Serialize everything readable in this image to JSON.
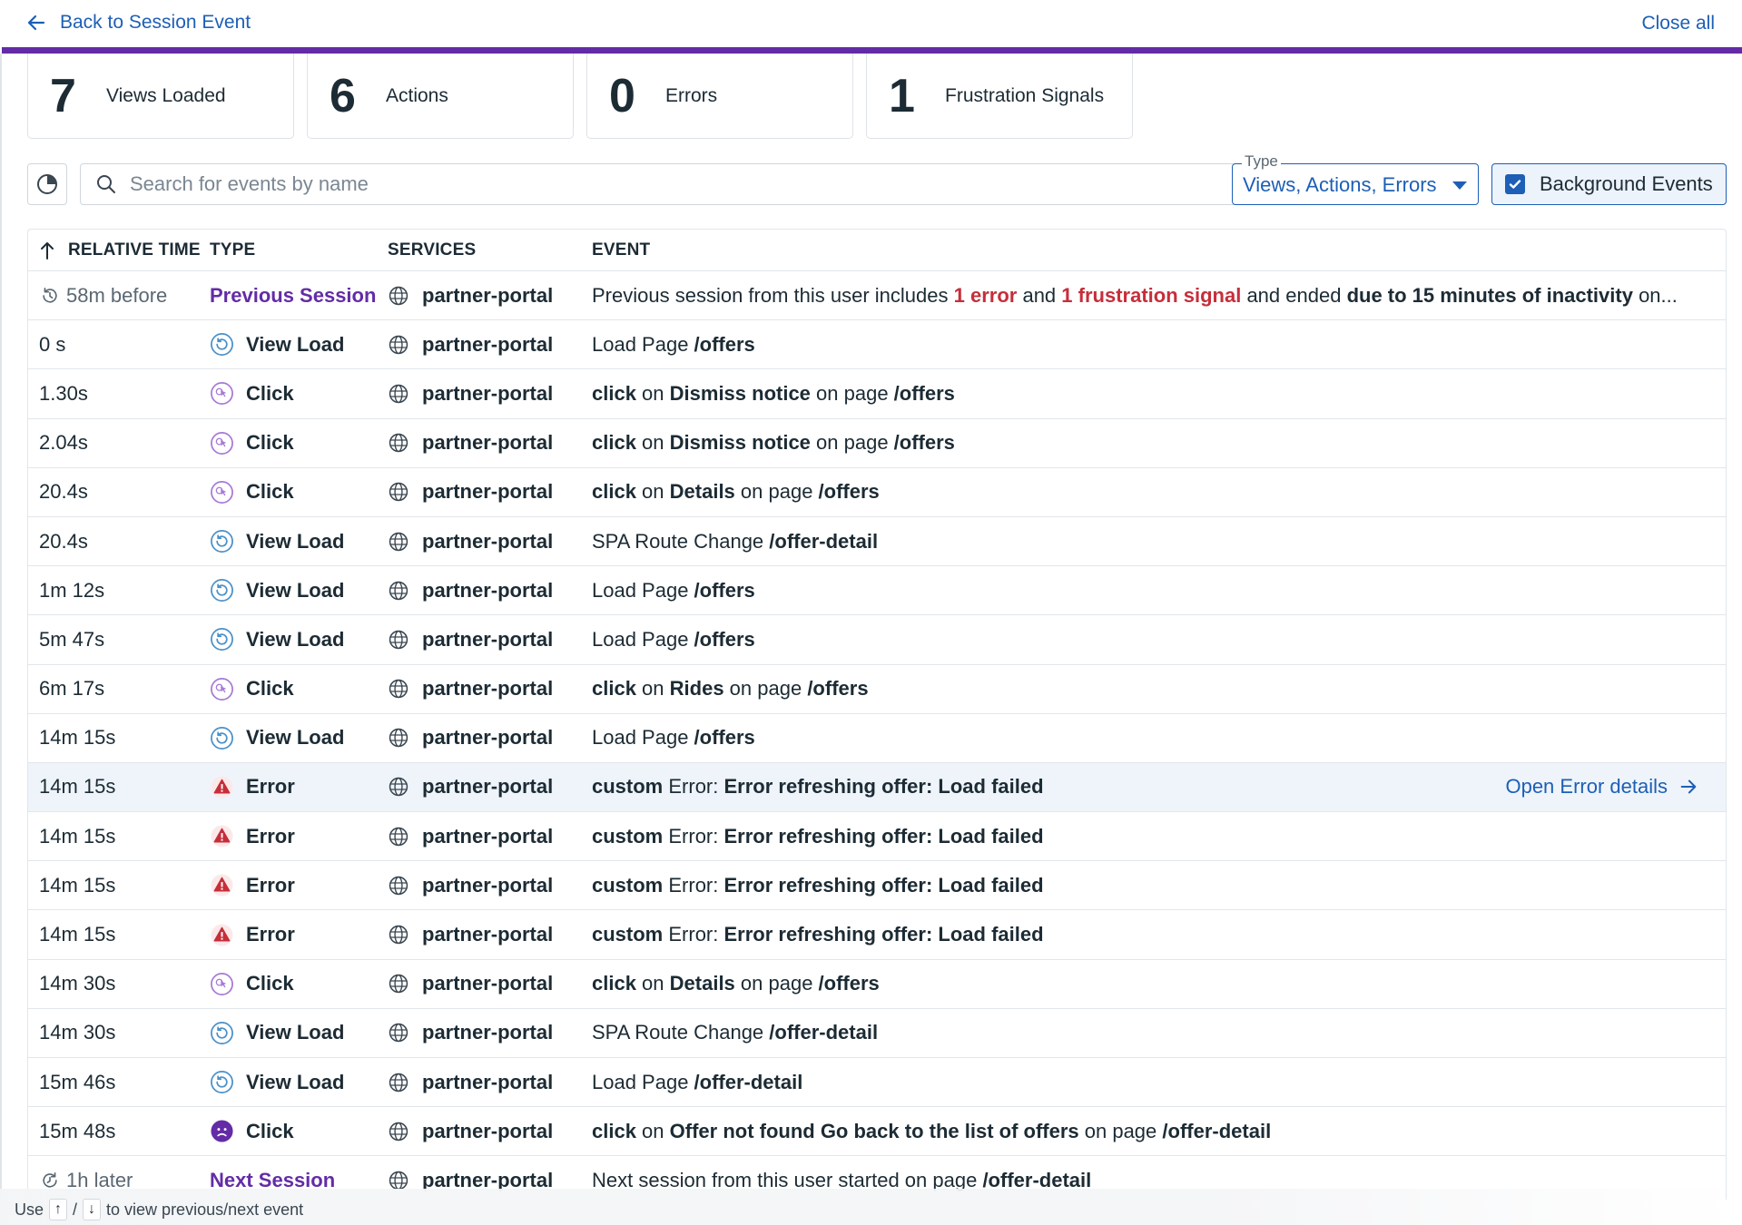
{
  "header": {
    "back_label": "Back to Session Event",
    "close_all_label": "Close all"
  },
  "summary": [
    {
      "count": "7",
      "label": "Views Loaded"
    },
    {
      "count": "6",
      "label": "Actions"
    },
    {
      "count": "0",
      "label": "Errors"
    },
    {
      "count": "1",
      "label": "Frustration Signals"
    }
  ],
  "filters": {
    "search_placeholder": "Search for events by name",
    "type_legend": "Type",
    "type_value": "Views, Actions, Errors",
    "background_events_label": "Background Events",
    "background_events_checked": true
  },
  "table": {
    "columns": [
      "RELATIVE TIME",
      "TYPE",
      "SERVICES",
      "EVENT"
    ],
    "rows": [
      {
        "time": "58m before",
        "type": "Previous Session",
        "kind": "prev",
        "service": "partner-portal",
        "event": [
          [
            "t",
            "Previous session from this user includes "
          ],
          [
            "r",
            "1 error"
          ],
          [
            "t",
            " and "
          ],
          [
            "r",
            "1 frustration signal"
          ],
          [
            "t",
            " and ended "
          ],
          [
            "b",
            "due to 15 minutes of inactivity"
          ],
          [
            "t",
            " on..."
          ]
        ]
      },
      {
        "time": "0 s",
        "type": "View Load",
        "kind": "view",
        "service": "partner-portal",
        "event": [
          [
            "t",
            "Load Page "
          ],
          [
            "b",
            "/offers"
          ]
        ]
      },
      {
        "time": "1.30s",
        "type": "Click",
        "kind": "click",
        "service": "partner-portal",
        "event": [
          [
            "b",
            "click"
          ],
          [
            "t",
            " on "
          ],
          [
            "b",
            "Dismiss notice"
          ],
          [
            "t",
            " on page "
          ],
          [
            "b",
            "/offers"
          ]
        ]
      },
      {
        "time": "2.04s",
        "type": "Click",
        "kind": "click",
        "service": "partner-portal",
        "event": [
          [
            "b",
            "click"
          ],
          [
            "t",
            " on "
          ],
          [
            "b",
            "Dismiss notice"
          ],
          [
            "t",
            " on page "
          ],
          [
            "b",
            "/offers"
          ]
        ]
      },
      {
        "time": "20.4s",
        "type": "Click",
        "kind": "click",
        "service": "partner-portal",
        "event": [
          [
            "b",
            "click"
          ],
          [
            "t",
            " on "
          ],
          [
            "b",
            "Details"
          ],
          [
            "t",
            " on page "
          ],
          [
            "b",
            "/offers"
          ]
        ]
      },
      {
        "time": "20.4s",
        "type": "View Load",
        "kind": "view",
        "service": "partner-portal",
        "event": [
          [
            "t",
            "SPA Route Change "
          ],
          [
            "b",
            "/offer-detail"
          ]
        ]
      },
      {
        "time": "1m 12s",
        "type": "View Load",
        "kind": "view",
        "service": "partner-portal",
        "event": [
          [
            "t",
            "Load Page "
          ],
          [
            "b",
            "/offers"
          ]
        ]
      },
      {
        "time": "5m 47s",
        "type": "View Load",
        "kind": "view",
        "service": "partner-portal",
        "event": [
          [
            "t",
            "Load Page "
          ],
          [
            "b",
            "/offers"
          ]
        ]
      },
      {
        "time": "6m 17s",
        "type": "Click",
        "kind": "click",
        "service": "partner-portal",
        "event": [
          [
            "b",
            "click"
          ],
          [
            "t",
            " on "
          ],
          [
            "b",
            "Rides"
          ],
          [
            "t",
            " on page "
          ],
          [
            "b",
            "/offers"
          ]
        ]
      },
      {
        "time": "14m 15s",
        "type": "View Load",
        "kind": "view",
        "service": "partner-portal",
        "event": [
          [
            "t",
            "Load Page "
          ],
          [
            "b",
            "/offers"
          ]
        ]
      },
      {
        "time": "14m 15s",
        "type": "Error",
        "kind": "error",
        "service": "partner-portal",
        "highlighted": true,
        "action": "Open Error details",
        "event": [
          [
            "b",
            "custom"
          ],
          [
            "t",
            " Error: "
          ],
          [
            "b",
            "Error refreshing offer: Load failed"
          ]
        ]
      },
      {
        "time": "14m 15s",
        "type": "Error",
        "kind": "error",
        "service": "partner-portal",
        "event": [
          [
            "b",
            "custom"
          ],
          [
            "t",
            " Error: "
          ],
          [
            "b",
            "Error refreshing offer: Load failed"
          ]
        ]
      },
      {
        "time": "14m 15s",
        "type": "Error",
        "kind": "error",
        "service": "partner-portal",
        "event": [
          [
            "b",
            "custom"
          ],
          [
            "t",
            " Error: "
          ],
          [
            "b",
            "Error refreshing offer: Load failed"
          ]
        ]
      },
      {
        "time": "14m 15s",
        "type": "Error",
        "kind": "error",
        "service": "partner-portal",
        "event": [
          [
            "b",
            "custom"
          ],
          [
            "t",
            " Error: "
          ],
          [
            "b",
            "Error refreshing offer: Load failed"
          ]
        ]
      },
      {
        "time": "14m 30s",
        "type": "Click",
        "kind": "click",
        "service": "partner-portal",
        "event": [
          [
            "b",
            "click"
          ],
          [
            "t",
            " on "
          ],
          [
            "b",
            "Details"
          ],
          [
            "t",
            " on page "
          ],
          [
            "b",
            "/offers"
          ]
        ]
      },
      {
        "time": "14m 30s",
        "type": "View Load",
        "kind": "view",
        "service": "partner-portal",
        "event": [
          [
            "t",
            "SPA Route Change "
          ],
          [
            "b",
            "/offer-detail"
          ]
        ]
      },
      {
        "time": "15m 46s",
        "type": "View Load",
        "kind": "view",
        "service": "partner-portal",
        "event": [
          [
            "t",
            "Load Page "
          ],
          [
            "b",
            "/offer-detail"
          ]
        ]
      },
      {
        "time": "15m 48s",
        "type": "Click",
        "kind": "frustration",
        "service": "partner-portal",
        "event": [
          [
            "b",
            "click"
          ],
          [
            "t",
            " on "
          ],
          [
            "b",
            "Offer not found Go back to the list of offers"
          ],
          [
            "t",
            " on page "
          ],
          [
            "b",
            "/offer-detail"
          ]
        ]
      },
      {
        "time": "1h later",
        "type": "Next Session",
        "kind": "next",
        "service": "partner-portal",
        "event": [
          [
            "t",
            "Next session from this user started on page "
          ],
          [
            "b",
            "/offer-detail"
          ]
        ]
      }
    ]
  },
  "footer": {
    "prefix": "Use",
    "up_key": "↑",
    "separator": "/",
    "down_key": "↓",
    "suffix": "to view previous/next event"
  },
  "colors": {
    "accent_purple": "#632ca6",
    "link_blue": "#1d5fb6",
    "error_red": "#c62e3a",
    "view_blue": "#4a90c8",
    "click_purple": "#a779d6"
  },
  "icons": {
    "view": "view-load-icon",
    "click": "click-icon",
    "error": "error-icon",
    "frustration": "frustration-icon",
    "prev": "history-icon",
    "next": "next-session-icon",
    "service": "globe-icon"
  }
}
